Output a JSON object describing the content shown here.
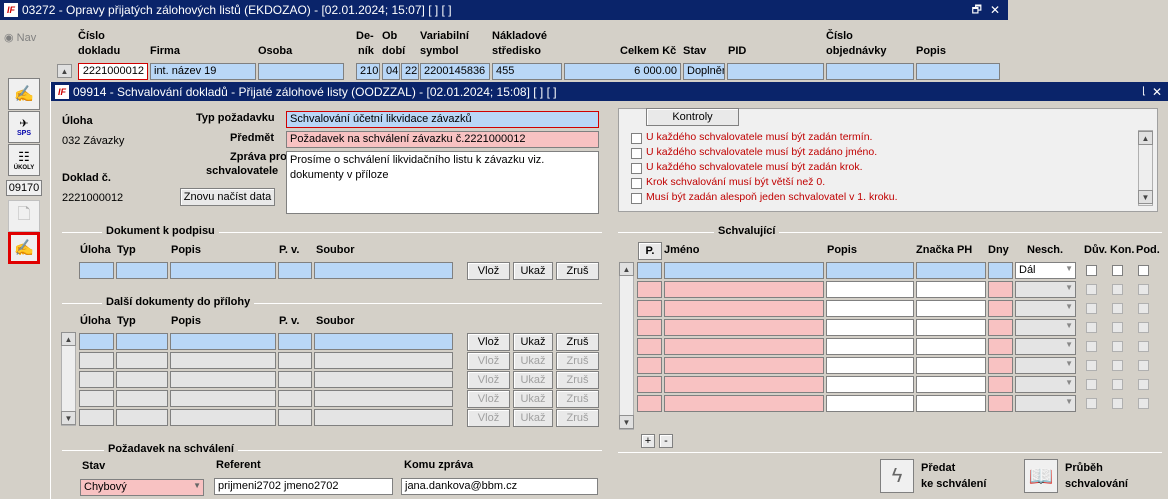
{
  "back": {
    "title": "03272 - Opravy přijatých zálohových listů (EKDOZAO) - [02.01.2024; 15:07] [ ] [ ]",
    "nav": "Nav",
    "cols": {
      "cislo": "Číslo",
      "dokladu": "dokladu",
      "firma": "Firma",
      "osoba": "Osoba",
      "de": "De-",
      "nik": "ník",
      "ob": "Ob",
      "dobi": "dobí",
      "variabilni": "Variabilní",
      "symbol": "symbol",
      "nakladove": "Nákladové",
      "stredisko": "středisko",
      "celkem": "Celkem Kč",
      "stav": "Stav",
      "pid": "PID",
      "cislo2": "Číslo",
      "objednavky": "objednávky",
      "popis": "Popis"
    },
    "row": {
      "doklad": "2221000012",
      "firma": "int. název 19",
      "den": "210",
      "ob1": "04",
      "ob2": "22",
      "vs": "2200145836",
      "stredisko": "455",
      "celkem": "6 000.00",
      "stav": "Doplněn"
    },
    "toolbar_num": "09170",
    "sps": "SPS",
    "ukoly": "ÚKOLY"
  },
  "front": {
    "title": "09914 - Schvalování dokladů - Přijaté zálohové listy (OODZZAL) - [02.01.2024; 15:08] [ ] [ ]",
    "uloha_lbl": "Úloha",
    "uloha_val": "032 Závazky",
    "doklad_lbl": "Doklad č.",
    "doklad_val": "2221000012",
    "typ_lbl": "Typ požadavku",
    "typ_val": "Schvalování účetní likvidace závazků",
    "predmet_lbl": "Předmět",
    "predmet_val": "Požadavek na schválení závazku č.2221000012",
    "zprava_lbl1": "Zpráva pro",
    "zprava_lbl2": "schvalovatele",
    "zprava_val": "Prosíme o schválení likvidačního listu k závazku viz. dokumenty v příloze",
    "reload_btn": "Znovu načíst data",
    "kontroly_btn": "Kontroly",
    "errors": [
      "U každého schvalovatele musí být zadán termín.",
      "U každého schvalovatele musí být zadáno jméno.",
      "U každého schvalovatele musí být zadán krok.",
      "Krok schvalování musí být větší než 0.",
      "Musí být zadán alespoň jeden schvalovatel v 1. kroku."
    ],
    "dok_podpis": "Dokument k podpisu",
    "dalsi_dok": "Další dokumenty do přílohy",
    "doc_cols": {
      "uloha": "Úloha",
      "typ": "Typ",
      "popis": "Popis",
      "pv": "P. v.",
      "soubor": "Soubor"
    },
    "btn_vloz": "Vlož",
    "btn_ukaz": "Ukaž",
    "btn_zrus": "Zruš",
    "pozadavek": "Požadavek na schválení",
    "stav_lbl": "Stav",
    "stav_val": "Chybový",
    "referent_lbl": "Referent",
    "referent_val": "prijmeni2702 jmeno2702",
    "komu_lbl": "Komu zpráva",
    "komu_val": "jana.dankova@bbm.cz",
    "schvalujici": "Schvalující",
    "schv_cols": {
      "p": "P.",
      "jmeno": "Jméno",
      "popis": "Popis",
      "znacka": "Značka PH",
      "dny": "Dny",
      "nesch": "Nesch.",
      "duv": "Dův.",
      "kon": "Kon.",
      "pod": "Pod."
    },
    "nesch_val": "Dál",
    "plus": "+",
    "minus": "-",
    "predat1": "Předat",
    "predat2": "ke schválení",
    "prubeh1": "Průběh",
    "prubeh2": "schvalování"
  }
}
